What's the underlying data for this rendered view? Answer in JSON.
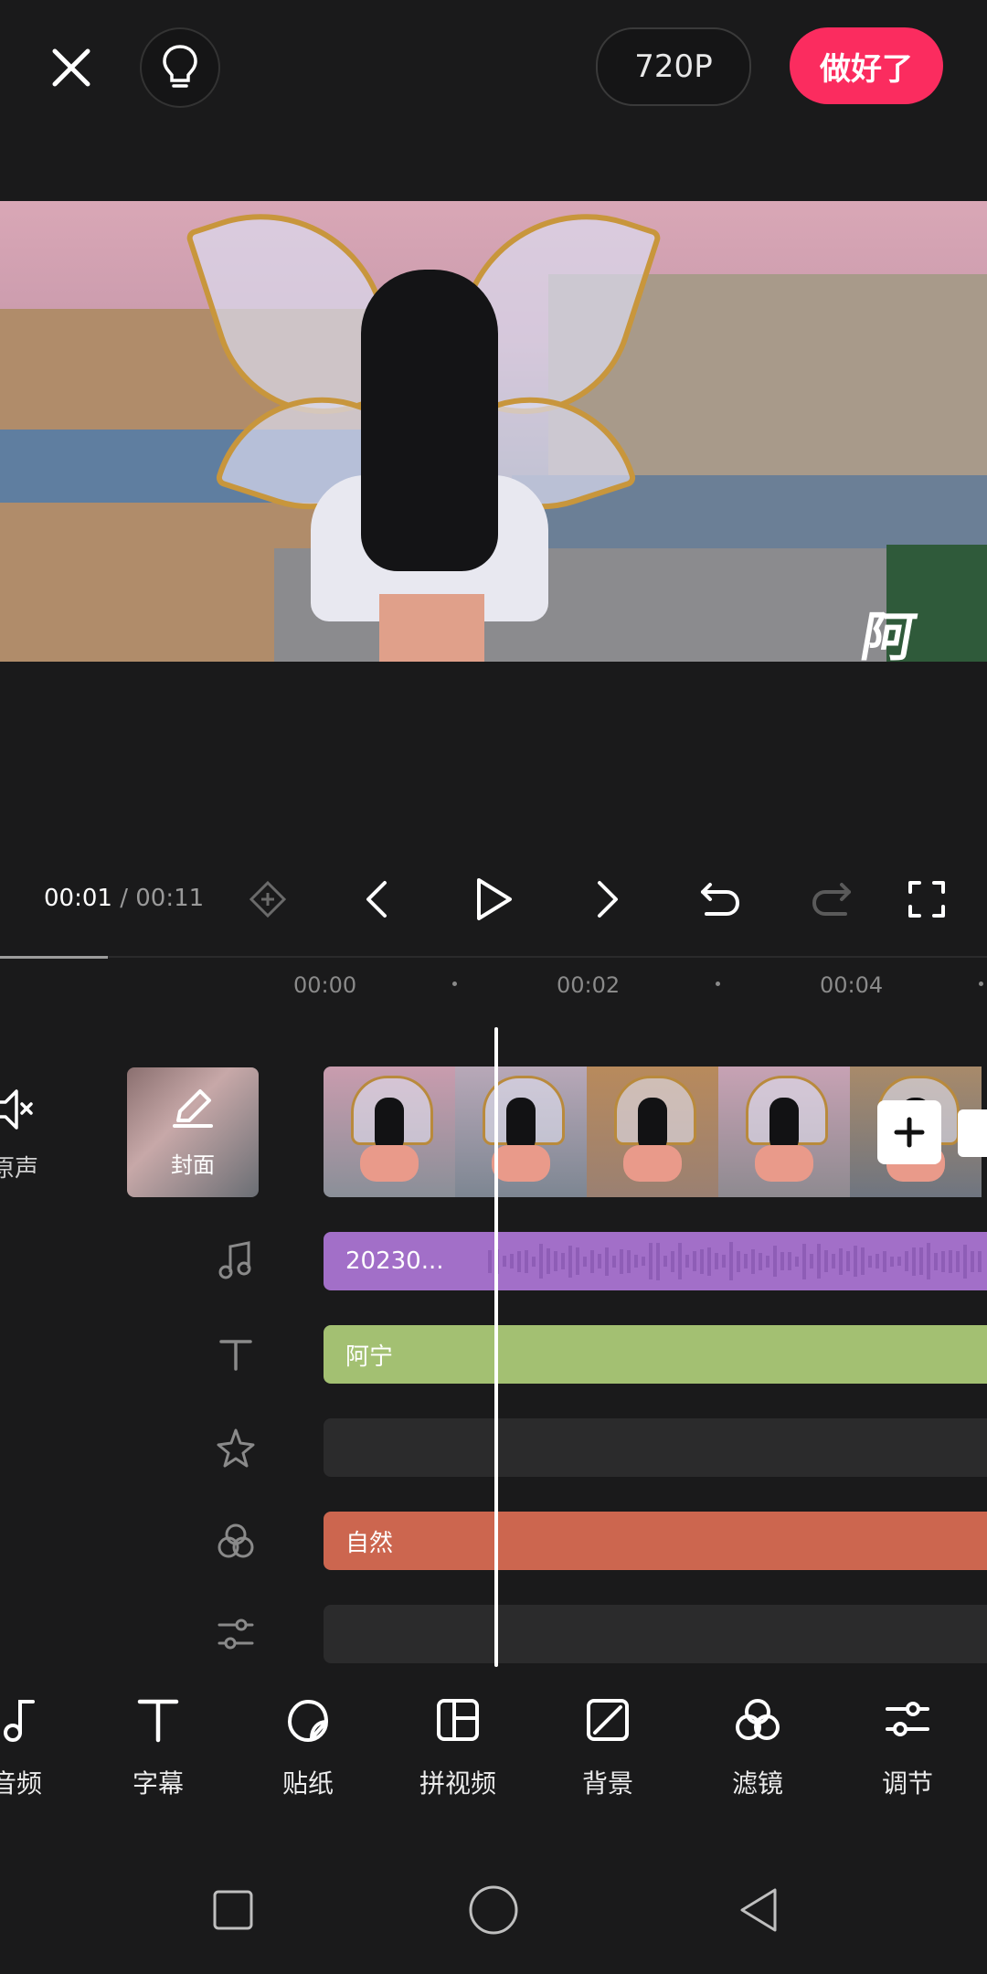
{
  "top_bar": {
    "resolution_label": "720P",
    "done_label": "做好了"
  },
  "preview": {
    "overlay_text": "阿"
  },
  "transport": {
    "current_time": "00:01",
    "separator": "/",
    "total_time": "00:11",
    "playhead_progress": 0.09
  },
  "ruler": {
    "ticks": [
      "00:00",
      "00:02",
      "00:04"
    ]
  },
  "left_panel": {
    "mute_label": "原声",
    "cover_label": "封面"
  },
  "tracks": {
    "audio_label": "20230...",
    "text_label": "阿宁",
    "filter_label": "自然"
  },
  "toolbar": {
    "items": [
      {
        "label": "音频",
        "icon": "music-icon"
      },
      {
        "label": "字幕",
        "icon": "text-icon"
      },
      {
        "label": "贴纸",
        "icon": "sticker-icon"
      },
      {
        "label": "拼视频",
        "icon": "layout-icon"
      },
      {
        "label": "背景",
        "icon": "background-icon"
      },
      {
        "label": "滤镜",
        "icon": "filter-icon"
      },
      {
        "label": "调节",
        "icon": "adjust-icon"
      }
    ]
  },
  "colors": {
    "accent": "#fb2c5f",
    "audio_track": "#a26fc8",
    "text_track": "#a3c072",
    "filter_track": "#cc664f",
    "background": "#1a1a1b"
  }
}
